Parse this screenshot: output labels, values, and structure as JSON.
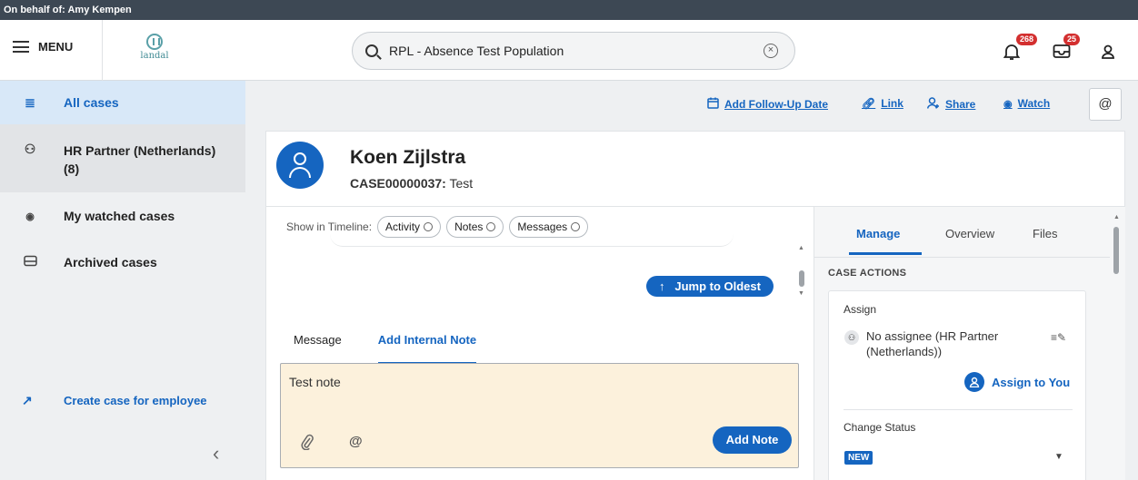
{
  "topbar": {
    "behalf": "On behalf of: Amy Kempen"
  },
  "header": {
    "menu_label": "MENU",
    "logo_text": "landal",
    "search_value": "RPL - Absence Test Population",
    "notifications_count": "268",
    "inbox_count": "25"
  },
  "sidebar": {
    "items": [
      {
        "label": "All cases",
        "icon": "list-icon"
      },
      {
        "label": "HR Partner (Netherlands)",
        "count": "(8)",
        "icon": "group-icon"
      },
      {
        "label": "My watched cases",
        "icon": "eye-icon"
      },
      {
        "label": "Archived cases",
        "icon": "archive-icon"
      }
    ],
    "create_label": "Create case for employee"
  },
  "actions": {
    "follow_up": "Add Follow-Up Date",
    "link": "Link",
    "share": "Share",
    "watch": "Watch",
    "mention": "@"
  },
  "case": {
    "name": "Koen Zijlstra",
    "number": "CASE00000037:",
    "subject": "Test"
  },
  "timeline": {
    "show_label": "Show in Timeline:",
    "filters": [
      "Activity",
      "Notes",
      "Messages"
    ],
    "jump_label": "Jump to Oldest",
    "tabs": [
      "Message",
      "Add Internal Note"
    ],
    "note_value": "Test note",
    "add_note_label": "Add Note"
  },
  "panel": {
    "tabs": [
      "Manage",
      "Overview",
      "Files"
    ],
    "section_title": "CASE ACTIONS",
    "assign_label": "Assign",
    "assignee_line1": "No assignee (HR Partner",
    "assignee_line2": "(Netherlands))",
    "assign_to_you": "Assign to You",
    "change_status_label": "Change Status",
    "status_value": "NEW"
  },
  "colors": {
    "accent": "#1565c0",
    "topbar": "#3d4854",
    "badge": "#d32f2f",
    "note_bg": "#fcf1dc"
  }
}
